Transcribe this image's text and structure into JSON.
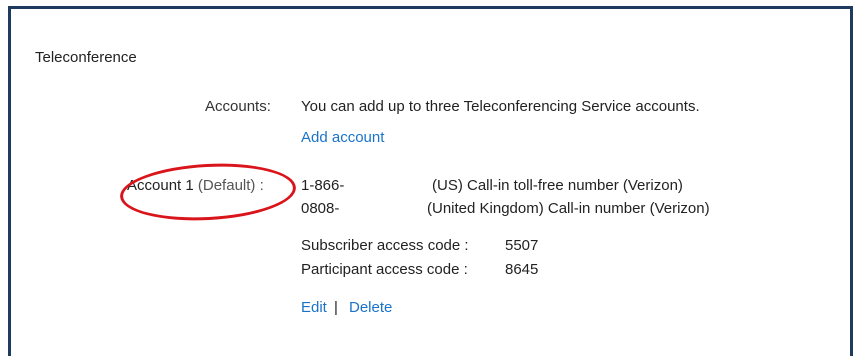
{
  "section": {
    "title": "Teleconference"
  },
  "accounts_row": {
    "label": "Accounts:",
    "info": "You can add up to three Teleconferencing Service accounts.",
    "add_link": "Add account"
  },
  "account": {
    "label_main": "Account 1",
    "label_default": "(Default) :",
    "numbers": [
      {
        "number": "1-866-",
        "description": "(US) Call-in toll-free number (Verizon)"
      },
      {
        "number": "0808-",
        "description": "(United Kingdom) Call-in number (Verizon)"
      }
    ],
    "codes": [
      {
        "label": "Subscriber access code :",
        "value": "5507"
      },
      {
        "label": "Participant access code :",
        "value": "8645"
      }
    ],
    "actions": {
      "edit": "Edit",
      "separator": "|",
      "delete": "Delete"
    }
  },
  "highlight": {
    "color": "#d9141a"
  },
  "colors": {
    "link": "#1a73c9",
    "frame": "#1f3a5f"
  }
}
